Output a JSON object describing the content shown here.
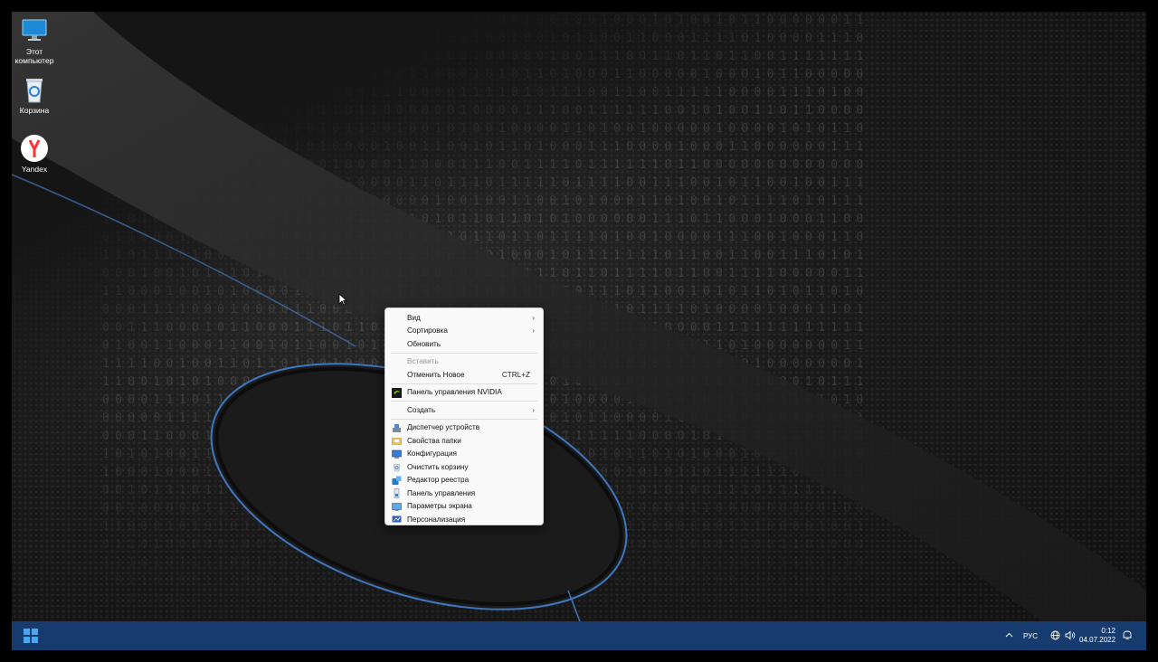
{
  "desktop": {
    "icons": [
      {
        "label": "Этот компьютер",
        "icon": "monitor-icon"
      },
      {
        "label": "Корзина",
        "icon": "recycle-bin-icon"
      },
      {
        "label": "Yandex",
        "icon": "yandex-browser-icon"
      }
    ]
  },
  "context_menu": {
    "view": {
      "label": "Вид"
    },
    "sort": {
      "label": "Сортировка"
    },
    "refresh": {
      "label": "Обновить"
    },
    "paste": {
      "label": "Вставить"
    },
    "undo_new": {
      "label": "Отменить Новое",
      "shortcut": "CTRL+Z"
    },
    "nvidia": {
      "label": "Панель управления NVIDIA",
      "icon": "nvidia-icon"
    },
    "create": {
      "label": "Создать"
    },
    "device_manager": {
      "label": "Диспетчер устройств",
      "icon": "device-manager-icon"
    },
    "folder_options": {
      "label": "Свойства папки",
      "icon": "folder-options-icon"
    },
    "config": {
      "label": "Конфигурация",
      "icon": "msconfig-icon"
    },
    "empty_bin": {
      "label": "Очистить корзину",
      "icon": "recycle-bin-icon"
    },
    "regedit": {
      "label": "Редактор реестра",
      "icon": "registry-editor-icon"
    },
    "control_panel": {
      "label": "Панель управления",
      "icon": "control-panel-icon"
    },
    "display": {
      "label": "Параметры экрана",
      "icon": "display-settings-icon"
    },
    "personalize": {
      "label": "Персонализация",
      "icon": "personalization-icon"
    }
  },
  "taskbar": {
    "language": "РУС",
    "time": "0:12",
    "date": "04.07.2022"
  },
  "colors": {
    "taskbar": "#163c6f",
    "start_accent": "#49a6f2",
    "menu_bg": "#f9f9f9"
  }
}
